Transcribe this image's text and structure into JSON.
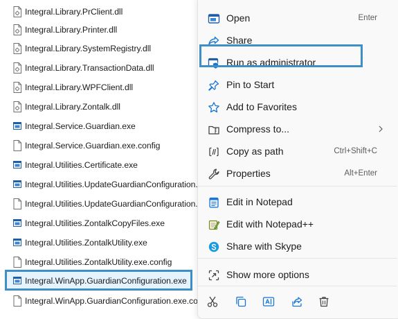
{
  "files": [
    {
      "name": "Integral.Library.PrClient.dll",
      "icon": "dll-file-icon"
    },
    {
      "name": "Integral.Library.Printer.dll",
      "icon": "dll-file-icon"
    },
    {
      "name": "Integral.Library.SystemRegistry.dll",
      "icon": "dll-file-icon"
    },
    {
      "name": "Integral.Library.TransactionData.dll",
      "icon": "dll-file-icon"
    },
    {
      "name": "Integral.Library.WPFClient.dll",
      "icon": "dll-file-icon"
    },
    {
      "name": "Integral.Library.Zontalk.dll",
      "icon": "dll-file-icon"
    },
    {
      "name": "Integral.Service.Guardian.exe",
      "icon": "exe-file-icon"
    },
    {
      "name": "Integral.Service.Guardian.exe.config",
      "icon": "config-file-icon"
    },
    {
      "name": "Integral.Utilities.Certificate.exe",
      "icon": "exe-file-icon"
    },
    {
      "name": "Integral.Utilities.UpdateGuardianConfiguration.",
      "icon": "exe-file-icon"
    },
    {
      "name": "Integral.Utilities.UpdateGuardianConfiguration.",
      "icon": "config-file-icon"
    },
    {
      "name": "Integral.Utilities.ZontalkCopyFiles.exe",
      "icon": "exe-file-icon"
    },
    {
      "name": "Integral.Utilities.ZontalkUtility.exe",
      "icon": "exe-file-icon"
    },
    {
      "name": "Integral.Utilities.ZontalkUtility.exe.config",
      "icon": "config-file-icon"
    },
    {
      "name": "Integral.WinApp.GuardianConfiguration.exe",
      "icon": "exe-file-icon",
      "selected": true
    },
    {
      "name": "Integral.WinApp.GuardianConfiguration.exe.co",
      "icon": "config-file-icon"
    }
  ],
  "menu": {
    "open": {
      "label": "Open",
      "shortcut": "Enter",
      "icon": "app-window-icon"
    },
    "share": {
      "label": "Share",
      "icon": "share-icon"
    },
    "run_admin": {
      "label": "Run as administrator",
      "icon": "shield-icon"
    },
    "pin_start": {
      "label": "Pin to Start",
      "icon": "pin-icon"
    },
    "add_favorites": {
      "label": "Add to Favorites",
      "icon": "star-icon"
    },
    "compress": {
      "label": "Compress to...",
      "icon": "zip-folder-icon"
    },
    "copy_path": {
      "label": "Copy as path",
      "shortcut": "Ctrl+Shift+C",
      "icon": "copy-path-icon"
    },
    "properties": {
      "label": "Properties",
      "shortcut": "Alt+Enter",
      "icon": "wrench-icon"
    },
    "edit_notepad": {
      "label": "Edit in Notepad",
      "icon": "notepad-icon"
    },
    "edit_notepadpp": {
      "label": "Edit with Notepad++",
      "icon": "notepadpp-icon"
    },
    "share_skype": {
      "label": "Share with Skype",
      "icon": "skype-icon"
    },
    "show_more": {
      "label": "Show more options",
      "icon": "show-more-icon"
    }
  },
  "toolbar": [
    "cut-icon",
    "copy-icon",
    "rename-icon",
    "share-icon",
    "delete-icon"
  ],
  "colors": {
    "highlight": "#3e8fc6",
    "accent": "#1976d2",
    "menu_bg": "#f9f9f9"
  }
}
